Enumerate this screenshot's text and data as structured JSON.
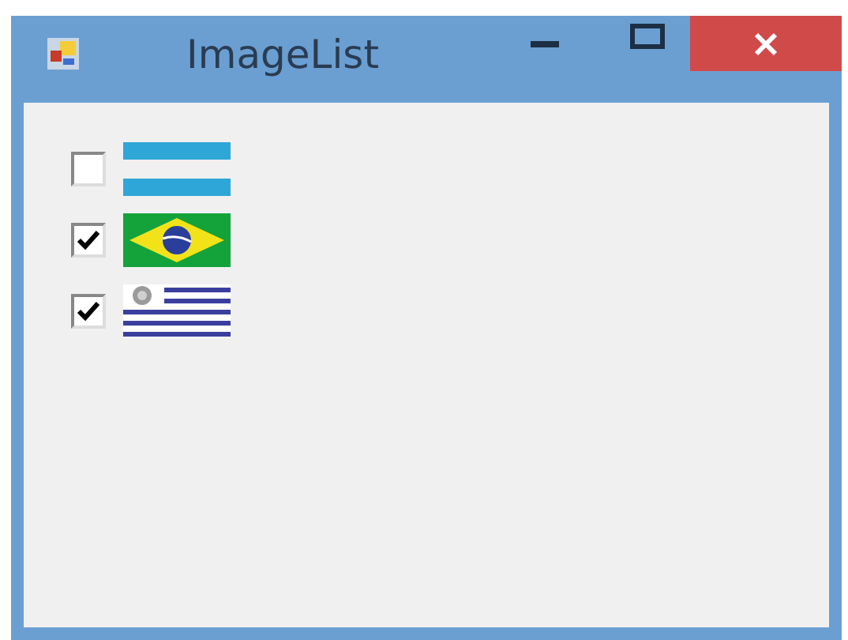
{
  "window": {
    "title": "ImageList"
  },
  "items": [
    {
      "kind": "bands",
      "checked": false
    },
    {
      "kind": "diamond",
      "checked": true
    },
    {
      "kind": "stripes-emblem",
      "checked": true
    }
  ]
}
